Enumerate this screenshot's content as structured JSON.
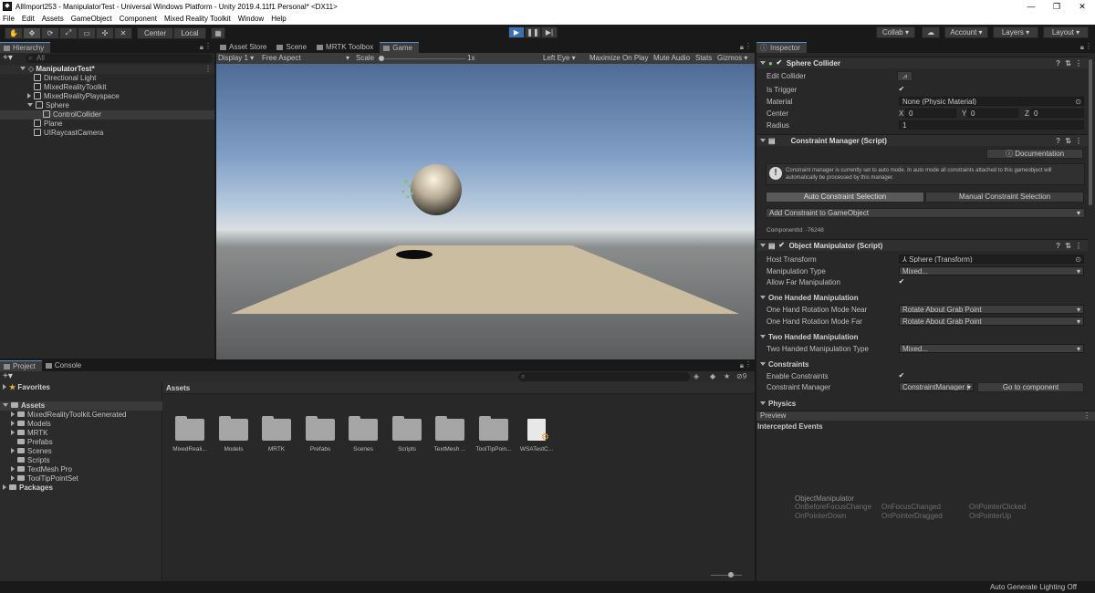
{
  "window": {
    "title": "AllImport253 - ManipulatorTest - Universal Windows Platform - Unity 2019.4.11f1 Personal* <DX11>",
    "controls": [
      "—",
      "❐",
      "✕"
    ]
  },
  "menu": [
    "File",
    "Edit",
    "Assets",
    "GameObject",
    "Component",
    "Mixed Reality Toolkit",
    "Window",
    "Help"
  ],
  "toolbar": {
    "pivot_label": "Center",
    "space_label": "Local",
    "collab_label": "Collab",
    "account_label": "Account",
    "layers_label": "Layers",
    "layout_label": "Layout"
  },
  "hierarchy": {
    "tab": "Hierarchy",
    "search_placeholder": "All",
    "scene": "ManipulatorTest*",
    "items": [
      "Directional Light",
      "MixedRealityToolkit",
      "MixedRealityPlayspace",
      "Sphere",
      "ControlCollider",
      "Plane",
      "UIRaycastCamera"
    ]
  },
  "scene_tabs": [
    "Asset Store",
    "Scene",
    "MRTK Toolbox",
    "Game"
  ],
  "game_bar": {
    "display": "Display 1",
    "aspect": "Free Aspect",
    "scale_label": "Scale",
    "scale_value": "1x",
    "eye": "Left Eye",
    "maximize": "Maximize On Play",
    "mute": "Mute Audio",
    "stats": "Stats",
    "gizmos": "Gizmos"
  },
  "project": {
    "tabs": [
      "Project",
      "Console"
    ],
    "favorites": "Favorites",
    "assets_root": "Assets",
    "tree": [
      "MixedRealityToolkit.Generated",
      "Models",
      "MRTK",
      "Prefabs",
      "Scenes",
      "Scripts",
      "TextMesh Pro",
      "ToolTipPointSet"
    ],
    "packages": "Packages",
    "breadcrumb": "Assets",
    "grid": [
      "MixedReali...",
      "Models",
      "MRTK",
      "Prefabs",
      "Scenes",
      "Scripts",
      "TextMesh ...",
      "ToolTipPoin...",
      "WSATestC..."
    ],
    "hidden_count": "9"
  },
  "inspector": {
    "tab": "Inspector",
    "sphere_collider": {
      "title": "Sphere Collider",
      "edit_collider": "Edit Collider",
      "is_trigger": "Is Trigger",
      "material_label": "Material",
      "material_value": "None (Physic Material)",
      "center_label": "Center",
      "center_x": "0",
      "center_y": "0",
      "center_z": "0",
      "radius_label": "Radius",
      "radius_value": "1"
    },
    "constraint_manager": {
      "title": "Constraint Manager (Script)",
      "documentation": "Documentation",
      "info": "Constraint manager is currently set to auto mode. In auto mode all constraints attached to this gameobject will automatically be processed by this manager.",
      "auto_btn": "Auto Constraint Selection",
      "manual_btn": "Manual Constraint Selection",
      "add_constraint": "Add Constraint to GameObject",
      "component_id": "ComponentId: -76248"
    },
    "object_manipulator": {
      "title": "Object Manipulator (Script)",
      "host_transform_label": "Host Transform",
      "host_transform_value": "Sphere (Transform)",
      "manipulation_type_label": "Manipulation Type",
      "manipulation_type_value": "Mixed...",
      "allow_far_label": "Allow Far Manipulation",
      "one_handed": "One Handed Manipulation",
      "rot_near_label": "One Hand Rotation Mode Near",
      "rot_near_value": "Rotate About Grab Point",
      "rot_far_label": "One Hand Rotation Mode Far",
      "rot_far_value": "Rotate About Grab Point",
      "two_handed": "Two Handed Manipulation",
      "two_type_label": "Two Handed Manipulation Type",
      "two_type_value": "Mixed...",
      "constraints": "Constraints",
      "enable_constraints": "Enable Constraints",
      "constraint_manager_label": "Constraint Manager",
      "constraint_manager_value": "ConstraintManager (",
      "go_to_component": "Go to component",
      "physics": "Physics"
    },
    "preview_label": "Preview",
    "intercepted_events": "Intercepted Events",
    "events_title": "ObjectManipulator",
    "events": [
      "OnBeforeFocusChange",
      "OnFocusChanged",
      "OnPointerClicked",
      "OnPointerDown",
      "OnPointerDragged",
      "OnPointerUp"
    ]
  },
  "status_bar": "Auto Generate Lighting Off"
}
